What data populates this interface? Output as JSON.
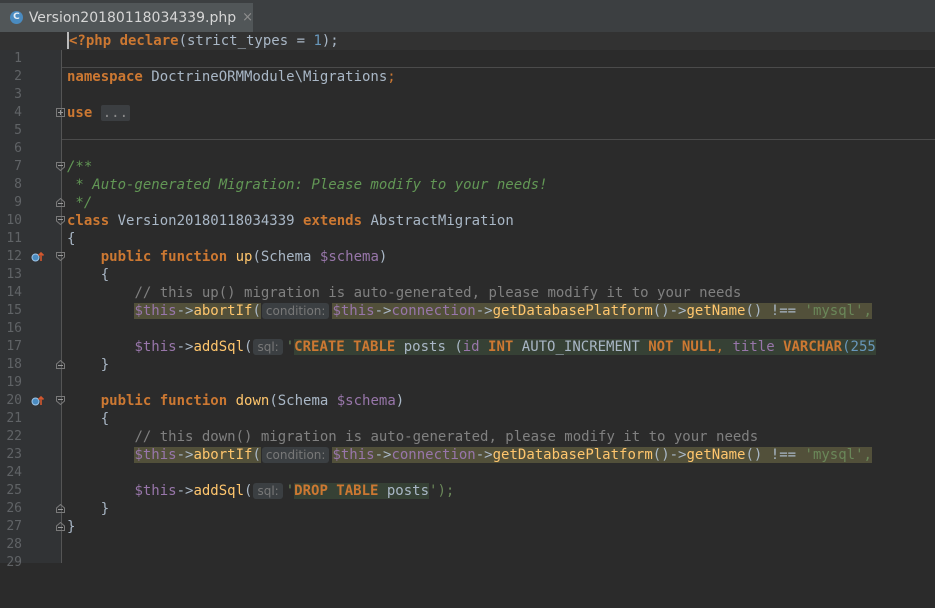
{
  "tab": {
    "icon_letter": "C",
    "title": "Version20180118034339.php",
    "close": "×"
  },
  "lines": [
    "1",
    "2",
    "3",
    "4",
    "5",
    "6",
    "7",
    "8",
    "9",
    "10",
    "11",
    "12",
    "13",
    "14",
    "15",
    "16",
    "17",
    "18",
    "19",
    "20",
    "21",
    "22",
    "23",
    "24",
    "25",
    "26",
    "27",
    "28",
    "29"
  ],
  "code": {
    "l1_kw": "<?php declare",
    "l1_rest": "(strict_types = ",
    "l1_num": "1",
    "l1_end": ");",
    "l3_kw": "namespace",
    "l3_ns": " DoctrineORMModule\\Migrations",
    "l3_semi": ";",
    "l5_kw": "use",
    "l5_fold": "...",
    "l8": "/**",
    "l9": " * Auto-generated Migration: Please modify to your needs!",
    "l10": " */",
    "l11_kw": "class",
    "l11_name": " Version20180118034339 ",
    "l11_ext": "extends",
    "l11_parent": " AbstractMigration",
    "l12": "{",
    "l13_pub": "public function",
    "l13_fn": "up",
    "l13_p1": "(Schema ",
    "l13_var": "$schema",
    "l13_p2": ")",
    "l14": "{",
    "l15": "// this up() migration is auto-generated, please modify it to your needs",
    "this": "$this",
    "arrow": "->",
    "abortIf": "abortIf",
    "paren_open": "(",
    "hint_condition": "condition:",
    "connection": "connection",
    "getDatabasePlatform": "getDatabasePlatform",
    "paren_pair": "()",
    "getName": "getName",
    "neq": " !== ",
    "mysql": "'mysql',",
    "addSql": "addSql",
    "hint_sql": "sql:",
    "quote": "'",
    "sql_create": "CREATE TABLE",
    "sql_posts": " posts (",
    "sql_id": "id ",
    "sql_int": "INT",
    "sql_autoinc": " AUTO_INCREMENT ",
    "sql_notnull": "NOT NULL",
    "sql_comma": ", ",
    "sql_title": "title ",
    "sql_varchar": "VARCHAR",
    "sql_len": "(255",
    "l19": "}",
    "l21_fn": "down",
    "l23": "// this down() migration is auto-generated, please modify it to your needs",
    "sql_drop": "DROP TABLE",
    "sql_drop_posts": " posts",
    "end_str": "');",
    "l27": "}",
    "l28": "}"
  }
}
